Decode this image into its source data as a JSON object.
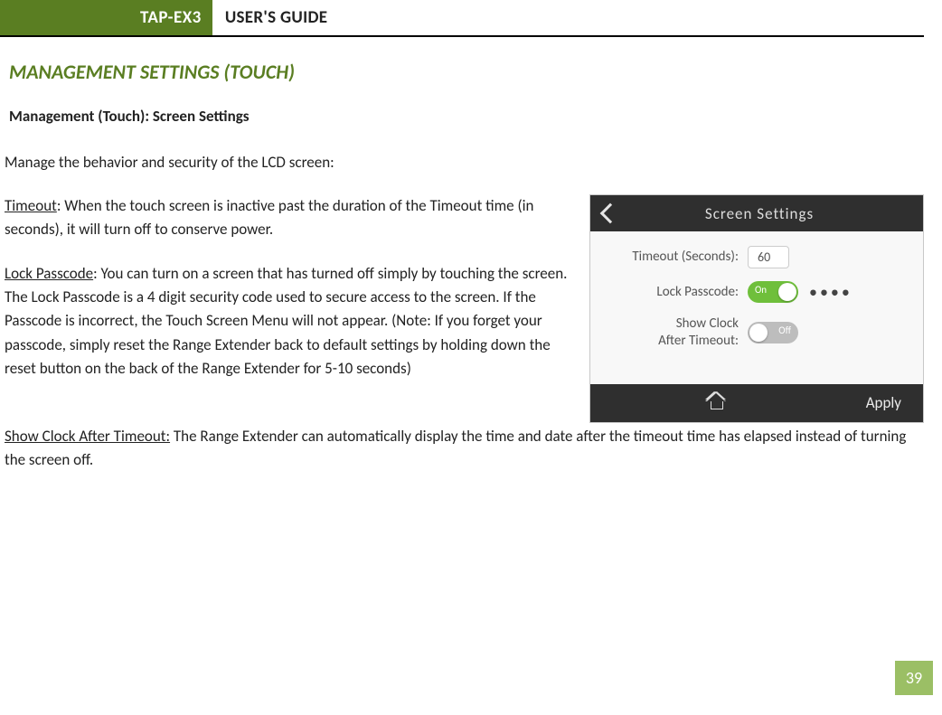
{
  "header": {
    "product": "TAP-EX3",
    "title": "USER'S GUIDE"
  },
  "section_title": "MANAGEMENT SETTINGS (TOUCH)",
  "subtitle": "Management (Touch): Screen Settings",
  "intro": "Manage the behavior and security of the LCD screen:",
  "timeout": {
    "label": "Timeout",
    "text": ":  When the touch screen is inactive past the duration of the Timeout time (in seconds), it will turn off to conserve power."
  },
  "lock_passcode": {
    "label": "Lock Passcode",
    "text": ": You can turn on a screen that has turned off simply by touching the screen.  The Lock Passcode is a 4 digit security code used to secure access to the screen.  If the Passcode is incorrect, the Touch Screen Menu will not appear. (Note: If you forget your passcode, simply reset the Range Extender back to default settings by holding down the reset button on the back of the Range Extender for 5-10 seconds)"
  },
  "show_clock": {
    "label": "Show Clock After Timeout:",
    "text": " The Range Extender can automatically display the time and date after the timeout time has elapsed instead of turning the screen off."
  },
  "screenshot": {
    "title": "Screen Settings",
    "timeout_label": "Timeout (Seconds):",
    "timeout_value": "60",
    "lock_label": "Lock Passcode:",
    "lock_toggle": "On",
    "lock_mask": "••••",
    "clock_label_line1": "Show Clock",
    "clock_label_line2": "After Timeout:",
    "clock_toggle": "Off",
    "apply": "Apply"
  },
  "page_number": "39"
}
